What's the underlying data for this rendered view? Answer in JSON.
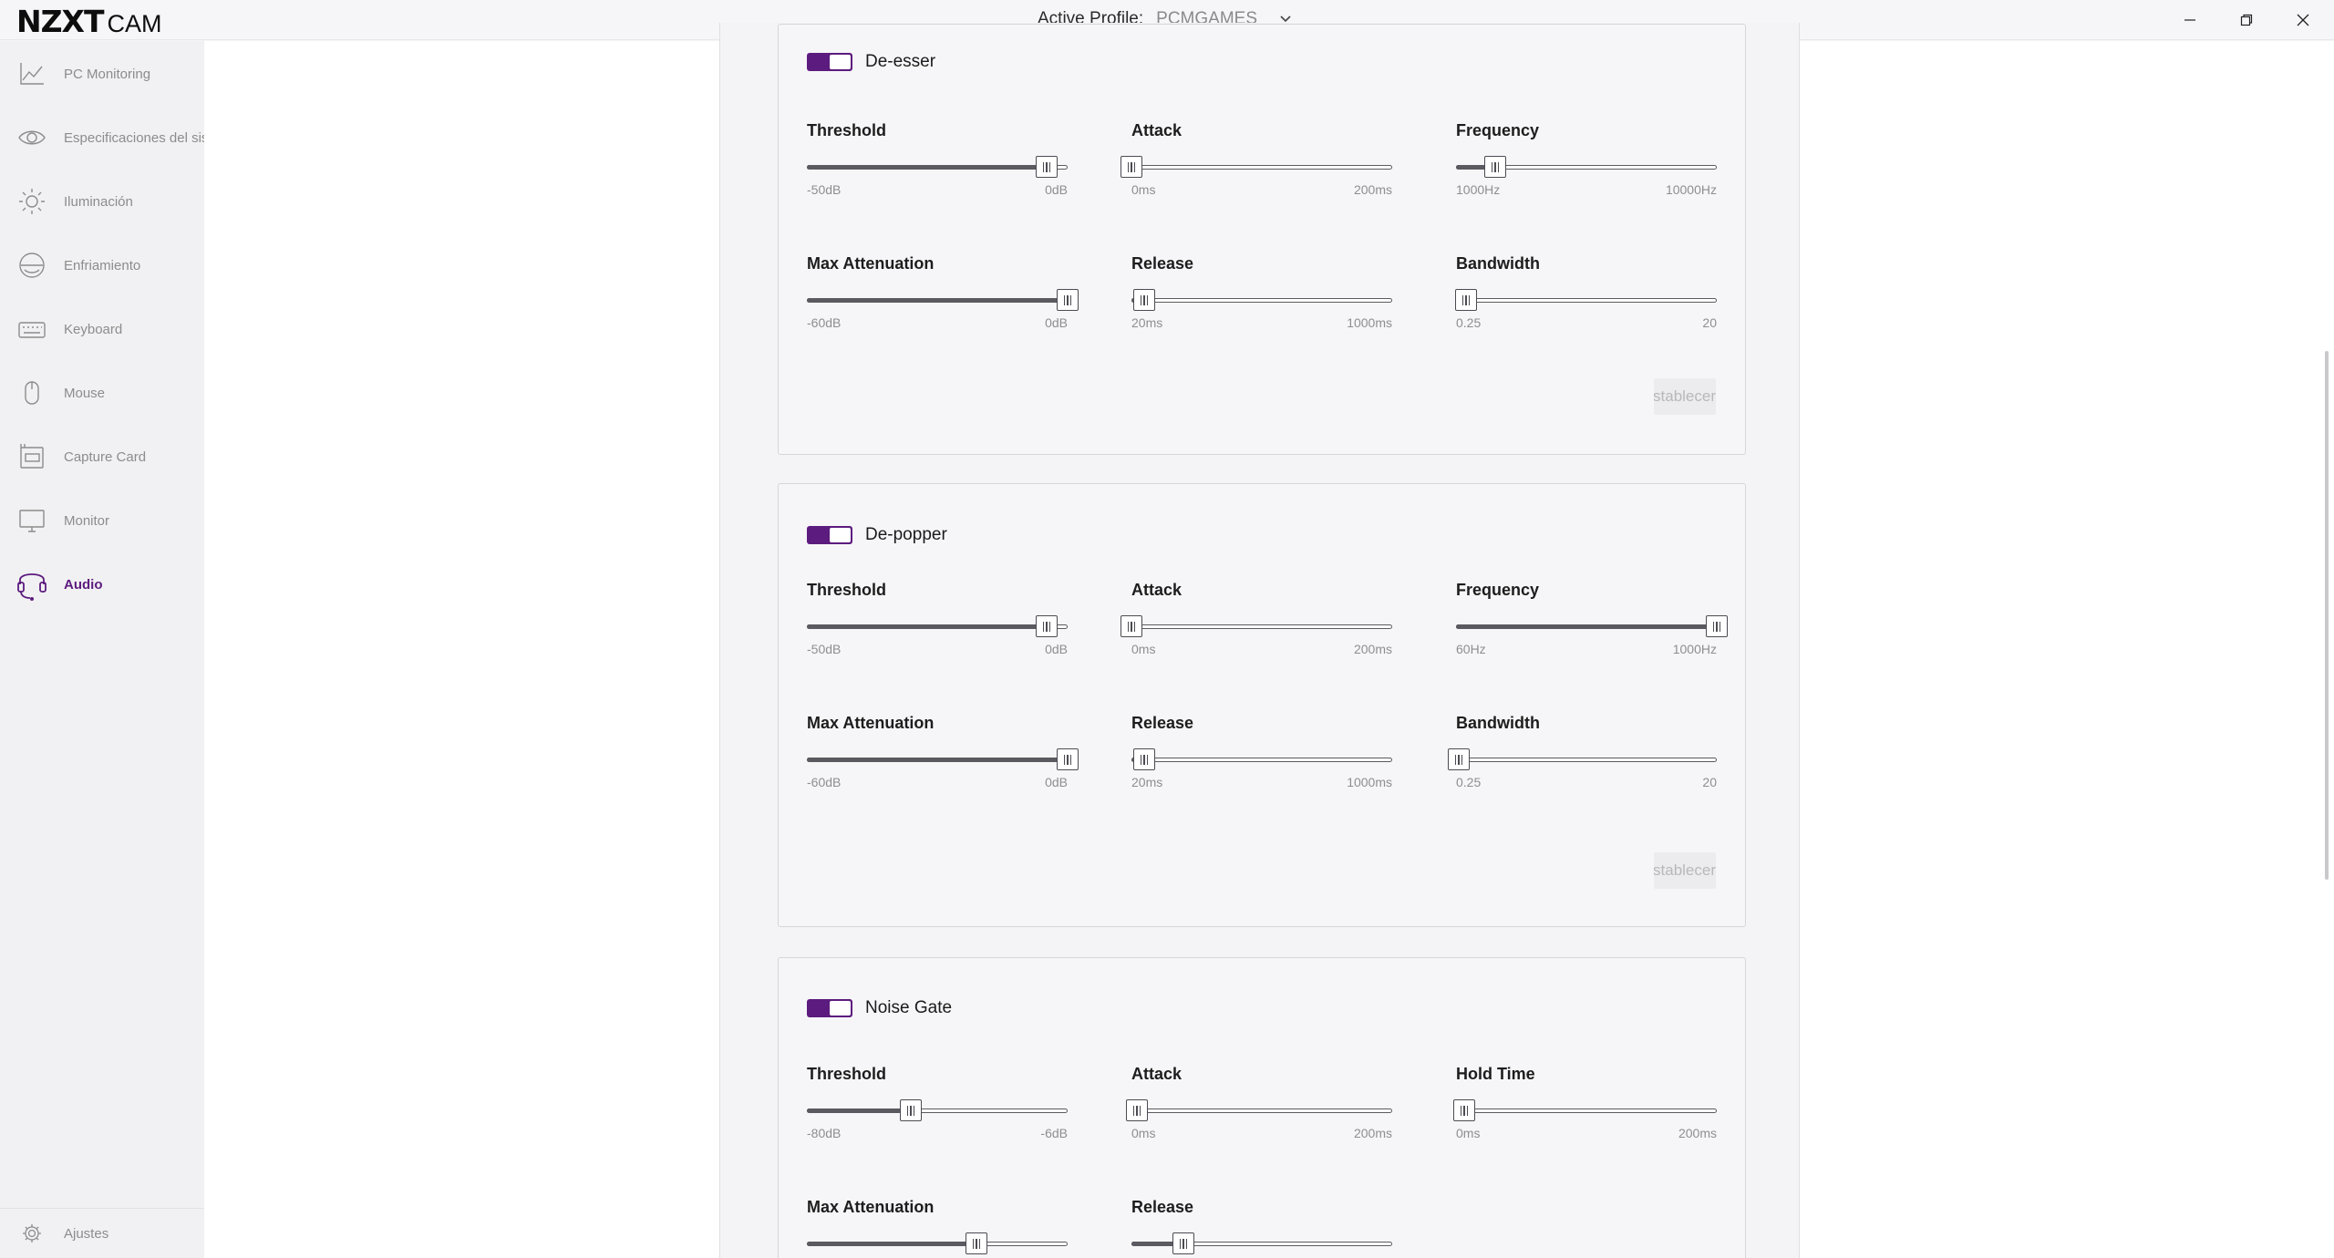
{
  "app": {
    "brand_bold": "NZXT",
    "brand_light": "CAM",
    "profile_label": "Active Profile:",
    "profile_value": "PCMGAMES"
  },
  "colors": {
    "accent": "#5c1b7e",
    "track": "#5a5a60"
  },
  "sidebar": {
    "items": [
      {
        "label": "PC Monitoring",
        "icon": "chart-line-icon"
      },
      {
        "label": "Especificaciones del sistema",
        "icon": "eye-icon"
      },
      {
        "label": "Iluminación",
        "icon": "sun-icon"
      },
      {
        "label": "Enfriamiento",
        "icon": "fan-icon"
      },
      {
        "label": "Keyboard",
        "icon": "keyboard-icon"
      },
      {
        "label": "Mouse",
        "icon": "mouse-icon"
      },
      {
        "label": "Capture Card",
        "icon": "capture-card-icon"
      },
      {
        "label": "Monitor",
        "icon": "monitor-icon"
      },
      {
        "label": "Audio",
        "icon": "headset-icon",
        "active": true
      }
    ],
    "settings_label": "Ajustes"
  },
  "reset_label": "Restablecer",
  "cards": [
    {
      "title": "De-esser",
      "enabled": true,
      "controls": [
        {
          "name": "Threshold",
          "min": "-50dB",
          "max": "0dB",
          "value": 0.92
        },
        {
          "name": "Attack",
          "min": "0ms",
          "max": "200ms",
          "value": 0.0
        },
        {
          "name": "Frequency",
          "min": "1000Hz",
          "max": "10000Hz",
          "value": 0.15
        },
        {
          "name": "Max Attenuation",
          "min": "-60dB",
          "max": "0dB",
          "value": 1.0
        },
        {
          "name": "Release",
          "min": "20ms",
          "max": "1000ms",
          "value": 0.05
        },
        {
          "name": "Bandwidth",
          "min": "0.25",
          "max": "20",
          "value": 0.04
        }
      ]
    },
    {
      "title": "De-popper",
      "enabled": true,
      "controls": [
        {
          "name": "Threshold",
          "min": "-50dB",
          "max": "0dB",
          "value": 0.92
        },
        {
          "name": "Attack",
          "min": "0ms",
          "max": "200ms",
          "value": 0.0
        },
        {
          "name": "Frequency",
          "min": "60Hz",
          "max": "1000Hz",
          "value": 1.0
        },
        {
          "name": "Max Attenuation",
          "min": "-60dB",
          "max": "0dB",
          "value": 1.0
        },
        {
          "name": "Release",
          "min": "20ms",
          "max": "1000ms",
          "value": 0.05
        },
        {
          "name": "Bandwidth",
          "min": "0.25",
          "max": "20",
          "value": 0.01
        }
      ]
    },
    {
      "title": "Noise Gate",
      "enabled": true,
      "controls": [
        {
          "name": "Threshold",
          "min": "-80dB",
          "max": "-6dB",
          "value": 0.4
        },
        {
          "name": "Attack",
          "min": "0ms",
          "max": "200ms",
          "value": 0.02
        },
        {
          "name": "Hold Time",
          "min": "0ms",
          "max": "200ms",
          "value": 0.03
        },
        {
          "name": "Max Attenuation",
          "value": 0.65
        },
        {
          "name": "Release",
          "value": 0.2
        }
      ]
    }
  ]
}
